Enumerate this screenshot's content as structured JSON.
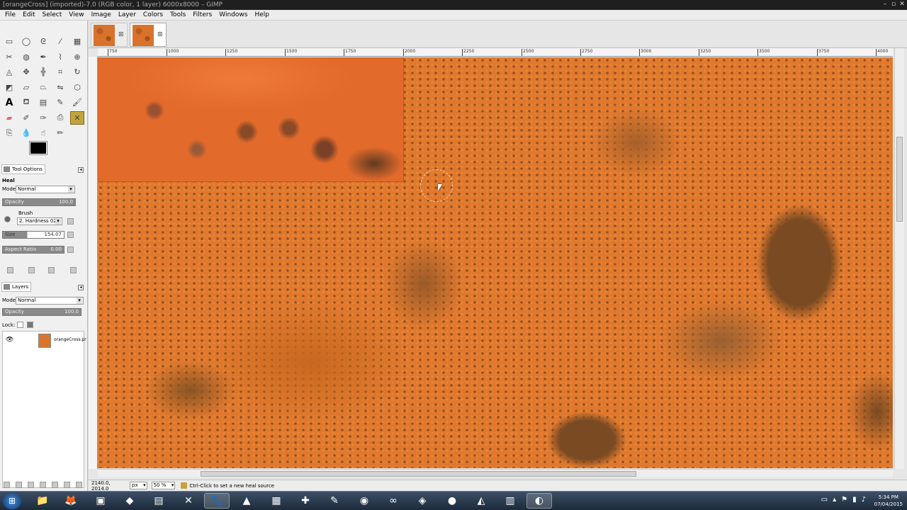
{
  "window": {
    "title": "[orangeCross] (imported)-7.0 (RGB color, 1 layer) 6000x8000 – GIMP",
    "controls": [
      "–",
      "▫",
      "✕"
    ]
  },
  "menu": [
    "File",
    "Edit",
    "Select",
    "View",
    "Image",
    "Layer",
    "Colors",
    "Tools",
    "Filters",
    "Windows",
    "Help"
  ],
  "toolbox": {
    "tools": [
      "rect-select",
      "ellipse-select",
      "free-select",
      "fuzzy-select",
      "select-by-color",
      "scissors",
      "foreground-select",
      "paths",
      "color-picker",
      "zoom",
      "measure",
      "move",
      "align",
      "crop",
      "rotate",
      "scale",
      "shear",
      "perspective",
      "flip",
      "cage-transform",
      "text",
      "bucket-fill",
      "blend",
      "pencil",
      "paintbrush",
      "eraser",
      "airbrush",
      "ink",
      "clone",
      "heal",
      "perspective-clone",
      "blur",
      "smudge",
      "dodge-burn"
    ],
    "active_tool": "heal",
    "colors": {
      "foreground": "#000000",
      "background": "#ffffff"
    }
  },
  "tool_options": {
    "tab_label": "Tool Options",
    "tool_name": "Heal",
    "mode_label": "Mode:",
    "mode_value": "Normal",
    "opacity_label": "Opacity",
    "opacity_value": "100.0",
    "brush_label": "Brush",
    "brush_value": "2. Hardness 025",
    "size_label": "Size",
    "size_value": "154.07",
    "aspect_label": "Aspect Ratio",
    "aspect_value": "0.00"
  },
  "layers": {
    "tab_label": "Layers",
    "mode_label": "Mode:",
    "mode_value": "Normal",
    "opacity_label": "Opacity",
    "opacity_value": "100.0",
    "lock_label": "Lock:",
    "items": [
      {
        "name": "orangeCross.pr"
      }
    ]
  },
  "ruler": {
    "ticks": [
      "750",
      "1000",
      "1250",
      "1500",
      "1750",
      "2000",
      "2250",
      "2500",
      "2750",
      "3000",
      "3250",
      "3500",
      "3750",
      "4000"
    ]
  },
  "status": {
    "coords": "2140.0, 2014.0",
    "unit": "px",
    "zoom": "50 %",
    "message": "Ctrl-Click to set a new heal source"
  },
  "taskbar": {
    "apps": [
      "explorer",
      "firefox",
      "app-3",
      "app-4",
      "app-5",
      "gimp",
      "app-7",
      "app-8",
      "app-9",
      "app-10",
      "app-11",
      "app-12",
      "app-13",
      "app-14",
      "visual-studio",
      "app-16",
      "app-17",
      "unity",
      "app-19",
      "app-20"
    ],
    "time": "5:34 PM",
    "date": "07/04/2015"
  }
}
